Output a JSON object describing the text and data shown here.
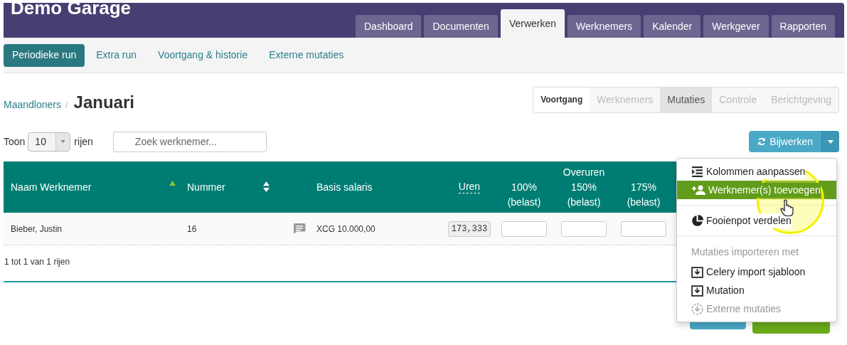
{
  "app_title": "Demo Garage",
  "main_tabs": [
    {
      "label": "Dashboard",
      "selected": false
    },
    {
      "label": "Documenten",
      "selected": false
    },
    {
      "label": "Verwerken",
      "selected": true
    },
    {
      "label": "Werknemers",
      "selected": false
    },
    {
      "label": "Kalender",
      "selected": false
    },
    {
      "label": "Werkgever",
      "selected": false
    },
    {
      "label": "Rapporten",
      "selected": false
    }
  ],
  "sub_tabs": [
    {
      "label": "Periodieke run",
      "selected": true
    },
    {
      "label": "Extra run",
      "selected": false
    },
    {
      "label": "Voortgang & historie",
      "selected": false
    },
    {
      "label": "Externe mutaties",
      "selected": false
    }
  ],
  "breadcrumb": {
    "parent": "Maandloners",
    "separator": "/",
    "current": "Januari"
  },
  "steps": {
    "title": "Voortgang",
    "items": [
      {
        "label": "Werknemers",
        "selected": false
      },
      {
        "label": "Mutaties",
        "selected": true
      },
      {
        "label": "Controle",
        "selected": false
      },
      {
        "label": "Berichtgeving",
        "selected": false
      }
    ]
  },
  "table_controls": {
    "show_label": "Toon",
    "page_size": "10",
    "rows_label": "rijen",
    "search_placeholder": "Zoek werknemer..."
  },
  "update_button": {
    "label": "Bijwerken"
  },
  "table": {
    "columns": [
      {
        "label": "Naam Werknemer",
        "sorted": true
      },
      {
        "label": "Nummer",
        "sorted": false
      },
      {
        "label": "Basis salaris"
      },
      {
        "label": "Uren"
      }
    ],
    "overtime": {
      "label": "Overuren",
      "columns": [
        {
          "rate": "100%",
          "note": "(belast)"
        },
        {
          "rate": "150%",
          "note": "(belast)"
        },
        {
          "rate": "175%",
          "note": "(belast)"
        }
      ]
    },
    "rows": [
      {
        "name": "Bieber, Justin",
        "number": "16",
        "salary": "XCG 10.000,00",
        "hours": "173,333"
      }
    ]
  },
  "footer_info": "1 tot 1 van 1 rijen",
  "menu": {
    "items": [
      {
        "kind": "columns",
        "label": "Kolommen aanpassen",
        "selected": false,
        "disabled": false
      },
      {
        "kind": "adduser",
        "label": "Werknemer(s) toevoegen",
        "selected": true,
        "disabled": false
      },
      {
        "kind": "divider"
      },
      {
        "kind": "tip",
        "label": "Fooienpot verdelen",
        "selected": false,
        "disabled": false
      },
      {
        "kind": "divider"
      },
      {
        "kind": "header",
        "label": "Mutaties importeren met"
      },
      {
        "kind": "import",
        "label": "Celery import sjabloon",
        "selected": false,
        "disabled": false
      },
      {
        "kind": "import",
        "label": "Mutation",
        "selected": false,
        "disabled": false
      },
      {
        "kind": "external",
        "label": "Externe mutaties",
        "selected": false,
        "disabled": true
      }
    ]
  }
}
